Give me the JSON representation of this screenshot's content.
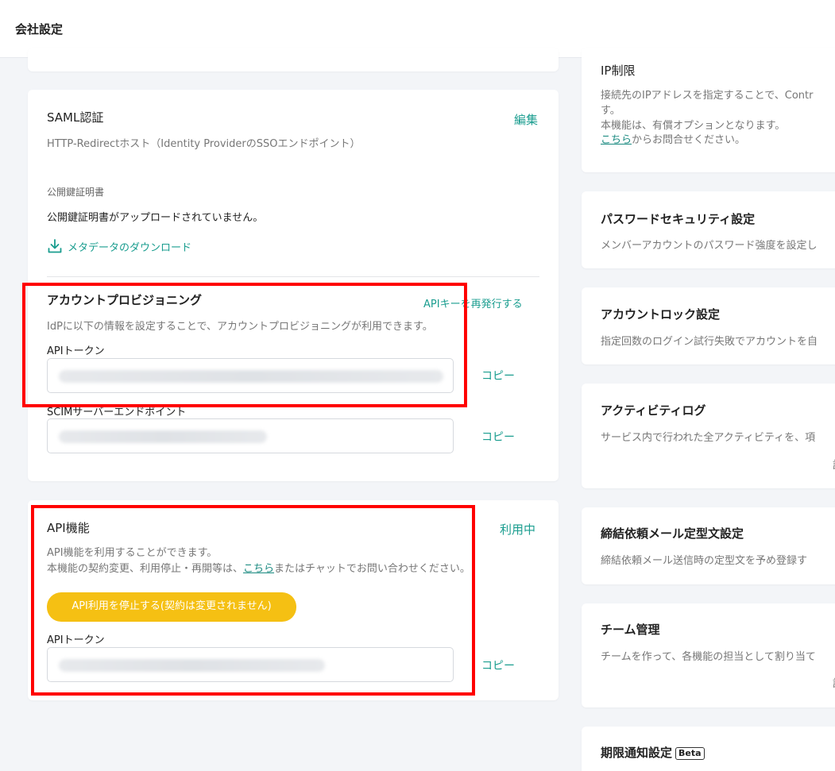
{
  "header": {
    "title": "会社設定"
  },
  "saml": {
    "title": "SAML認証",
    "edit": "編集",
    "subtitle": "HTTP-Redirectホスト（Identity ProviderのSSOエンドポイント）",
    "cert_label": "公開鍵証明書",
    "cert_status": "公開鍵証明書がアップロードされていません。",
    "download": "メタデータのダウンロード"
  },
  "provisioning": {
    "title": "アカウントプロビジョニング",
    "reissue": "APIキーを再発行する",
    "desc": "IdPに以下の情報を設定することで、アカウントプロビジョニングが利用できます。",
    "token_label": "APIトークン",
    "copy1": "コピー",
    "scim_label": "SCIMサーバーエンドポイント",
    "copy2": "コピー"
  },
  "api": {
    "title": "API機能",
    "status": "利用中",
    "desc1": "API機能を利用することができます。",
    "desc2_pre": "本機能の契約変更、利用停止・再開等は、",
    "desc2_link": "こちら",
    "desc2_post": "またはチャットでお問い合わせください。",
    "stop_button": "API利用を停止する(契約は変更されません)",
    "token_label": "APIトークン",
    "copy": "コピー"
  },
  "right": {
    "ip": {
      "title": "IP制限",
      "desc1": "接続先のIPアドレスを指定することで、Contr",
      "desc2": "す。",
      "desc3": "本機能は、有償オプションとなります。",
      "desc4_link": "こちら",
      "desc4_post": "からお問合せください。"
    },
    "password": {
      "title": "パスワードセキュリティ設定",
      "desc": "メンバーアカウントのパスワード強度を設定し"
    },
    "lock": {
      "title": "アカウントロック設定",
      "desc": "指定回数のログイン試行失敗でアカウントを自"
    },
    "activity": {
      "title": "アクティビティログ",
      "desc": "サービス内で行われた全アクティビティを、項",
      "more": "詳"
    },
    "mail": {
      "title": "締結依頼メール定型文設定",
      "desc": "締結依頼メール送信時の定型文を予め登録す"
    },
    "team": {
      "title": "チーム管理",
      "desc": "チームを作って、各機能の担当として割り当て",
      "more": "詳"
    },
    "deadline": {
      "title": "期限通知設定",
      "badge": "Beta"
    }
  },
  "colors": {
    "accent": "#1a9d8f",
    "highlight": "#ff0000",
    "button": "#f5c013"
  },
  "icons": {
    "download": "download-icon"
  }
}
